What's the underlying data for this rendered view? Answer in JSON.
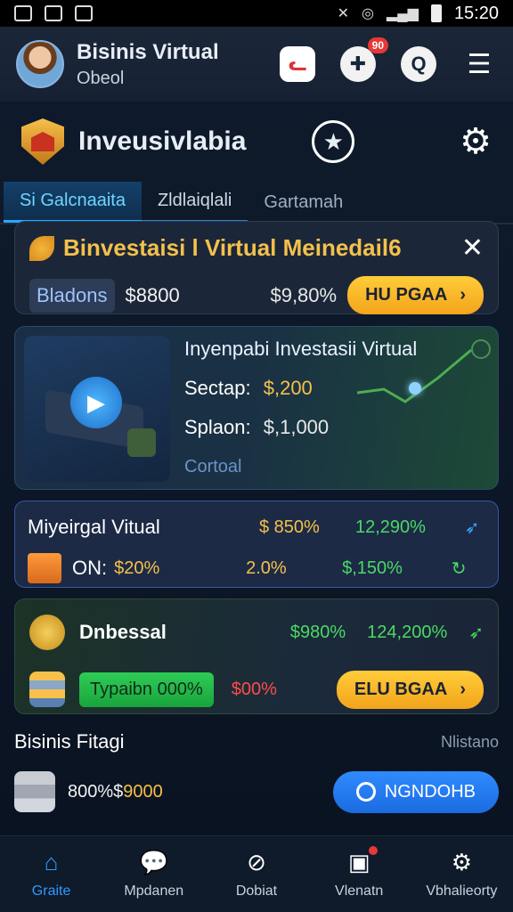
{
  "status_bar": {
    "time": "15:20"
  },
  "header": {
    "user_name": "Bisinis Virtual",
    "user_sub": "Obeol",
    "notif_count": "90"
  },
  "title_bar": {
    "title": "Inveusivlabia"
  },
  "tabs": [
    {
      "label": "Si Galcnaaita",
      "active": true
    },
    {
      "label": "Zldlaiqlali",
      "active": false
    },
    {
      "label": "Gartamah",
      "active": false
    }
  ],
  "promo": {
    "title": "Binvestaisi l Virtual Meinedail6",
    "label": "Bladons",
    "value": "$8800",
    "percent": "$9,80%",
    "button": "HU PGAA"
  },
  "feature": {
    "title": "Inyenpabi Investasii Virtual",
    "line1_key": "Sectap:",
    "line1_val": "$,200",
    "line2_key": "Splaon:",
    "line2_val": "$,1,000",
    "link": "Cortoal"
  },
  "stats": {
    "row1_label": "Miyeirgal Vitual",
    "row1_gold": "$ 850%",
    "row1_green": "12,290%",
    "row2_key": "ON:",
    "row2_gold": "$20%",
    "row2_mid": "2.0%",
    "row2_green": "$,150%"
  },
  "promo2": {
    "title": "Dnbessal",
    "green1": "$980%",
    "green2": "124,200%",
    "button_green": "Typaibn 000%",
    "red": "$00%",
    "button": "ELU BGAA"
  },
  "business": {
    "title": "Bisinis Fitagi",
    "link": "Nlistano",
    "value_text": "800%$",
    "value_gold": "9000",
    "button": "NGNDOHB"
  },
  "nav": [
    {
      "label": "Graite",
      "icon": "home-icon"
    },
    {
      "label": "Mpdanen",
      "icon": "chat-icon"
    },
    {
      "label": "Dobiat",
      "icon": "compass-icon"
    },
    {
      "label": "Vlenatn",
      "icon": "box-icon"
    },
    {
      "label": "Vbhalieorty",
      "icon": "settings-icon"
    }
  ],
  "colors": {
    "accent": "#2f9bff",
    "gold": "#f6c04a",
    "green": "#4cd964",
    "red": "#ff4b4b"
  }
}
